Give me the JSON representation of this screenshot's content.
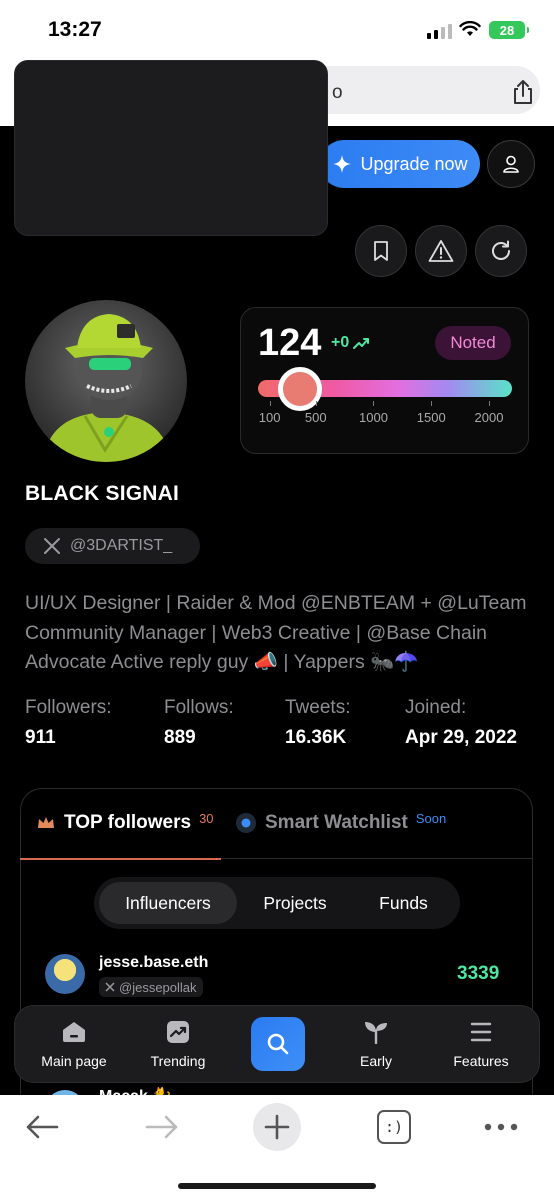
{
  "status_bar": {
    "time": "13:27",
    "battery": "28"
  },
  "browser": {
    "url_partial": "o"
  },
  "header": {
    "upgrade_label": "Upgrade now"
  },
  "profile": {
    "score": "124",
    "score_delta": "+0",
    "badge": "Noted",
    "slider": {
      "ticks": [
        "100",
        "500",
        "1000",
        "1500",
        "2000"
      ],
      "value": 124,
      "min": 0,
      "max": 2200
    },
    "name": "BLACK SIGNAI",
    "handle": "@3DARTIST_",
    "bio": "UI/UX Designer | Raider & Mod @ENBTEAM + @LuTeam Community Manager | Web3 Creative | @Base Chain Advocate Active reply guy 📣 | Yappers 🐜☂️",
    "stats": [
      {
        "label": "Followers:",
        "value": "911"
      },
      {
        "label": "Follows:",
        "value": "889"
      },
      {
        "label": "Tweets:",
        "value": "16.36K"
      },
      {
        "label": "Joined:",
        "value": "Apr 29, 2022"
      }
    ]
  },
  "followers_panel": {
    "tab_top": {
      "label": "TOP followers",
      "count": "30"
    },
    "tab_watchlist": {
      "label": "Smart Watchlist",
      "tag": "Soon"
    },
    "segments": [
      "Influencers",
      "Projects",
      "Funds"
    ],
    "rows": [
      {
        "name": "jesse.base.eth",
        "handle": "@jessepollak",
        "score": "3339"
      },
      {
        "name": "Macak 🐈"
      }
    ]
  },
  "bottom_nav": {
    "items": [
      {
        "label": "Main page",
        "icon": "home-icon"
      },
      {
        "label": "Trending",
        "icon": "trending-icon"
      },
      {
        "label": "",
        "icon": "search-icon"
      },
      {
        "label": "Early",
        "icon": "sprout-icon"
      },
      {
        "label": "Features",
        "icon": "menu-icon"
      }
    ]
  },
  "safari_toolbar": {
    "tabs_label": ":)"
  },
  "colors": {
    "accent_blue": "#2b7cf0",
    "score_green": "#4ee6a0",
    "noted_pink": "#f08ad6",
    "tab_underline": "#d96a52"
  }
}
